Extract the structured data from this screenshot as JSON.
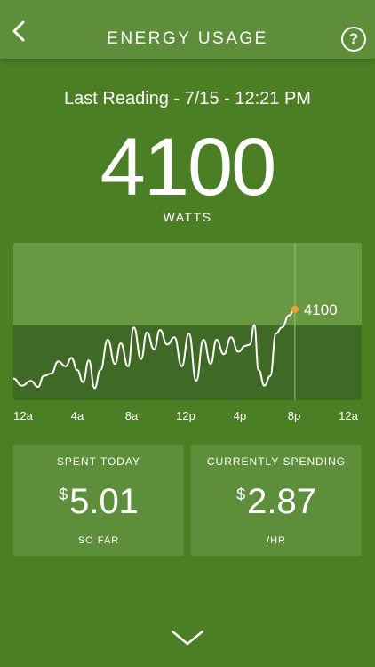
{
  "header": {
    "title": "ENERGY USAGE",
    "back_icon": "chevron-left-icon",
    "help_label": "?"
  },
  "reading": {
    "last_reading": "Last Reading - 7/15 - 12:21 PM",
    "value": "4100",
    "unit": "WATTS"
  },
  "chart_data": {
    "type": "line",
    "x_labels": [
      "12a",
      "4a",
      "8a",
      "12p",
      "4p",
      "8p",
      "12a"
    ],
    "current_value_label": "4100",
    "series": [
      {
        "values": [
          {
            "x": 0.0,
            "y": 0.18
          },
          {
            "x": 0.6,
            "y": 0.12
          },
          {
            "x": 1.2,
            "y": 0.16
          },
          {
            "x": 1.7,
            "y": 0.11
          },
          {
            "x": 2.1,
            "y": 0.2
          },
          {
            "x": 2.6,
            "y": 0.22
          },
          {
            "x": 3.1,
            "y": 0.32
          },
          {
            "x": 3.6,
            "y": 0.28
          },
          {
            "x": 4.0,
            "y": 0.35
          },
          {
            "x": 4.4,
            "y": 0.25
          },
          {
            "x": 4.8,
            "y": 0.15
          },
          {
            "x": 5.2,
            "y": 0.33
          },
          {
            "x": 5.6,
            "y": 0.1
          },
          {
            "x": 6.0,
            "y": 0.25
          },
          {
            "x": 6.5,
            "y": 0.5
          },
          {
            "x": 7.0,
            "y": 0.3
          },
          {
            "x": 7.4,
            "y": 0.47
          },
          {
            "x": 7.9,
            "y": 0.28
          },
          {
            "x": 8.3,
            "y": 0.6
          },
          {
            "x": 8.8,
            "y": 0.34
          },
          {
            "x": 9.2,
            "y": 0.56
          },
          {
            "x": 9.7,
            "y": 0.42
          },
          {
            "x": 10.1,
            "y": 0.58
          },
          {
            "x": 10.6,
            "y": 0.46
          },
          {
            "x": 11.1,
            "y": 0.52
          },
          {
            "x": 11.6,
            "y": 0.28
          },
          {
            "x": 12.1,
            "y": 0.55
          },
          {
            "x": 12.6,
            "y": 0.16
          },
          {
            "x": 13.1,
            "y": 0.5
          },
          {
            "x": 13.6,
            "y": 0.3
          },
          {
            "x": 14.0,
            "y": 0.5
          },
          {
            "x": 14.5,
            "y": 0.38
          },
          {
            "x": 15.0,
            "y": 0.52
          },
          {
            "x": 15.5,
            "y": 0.4
          },
          {
            "x": 16.0,
            "y": 0.45
          },
          {
            "x": 16.3,
            "y": 0.46
          },
          {
            "x": 16.6,
            "y": 0.62
          },
          {
            "x": 16.9,
            "y": 0.25
          },
          {
            "x": 17.3,
            "y": 0.12
          },
          {
            "x": 17.7,
            "y": 0.2
          },
          {
            "x": 18.1,
            "y": 0.55
          },
          {
            "x": 18.5,
            "y": 0.6
          },
          {
            "x": 19.0,
            "y": 0.7
          },
          {
            "x": 19.4,
            "y": 0.75
          }
        ]
      }
    ],
    "xlim": [
      0,
      24
    ],
    "ylim": [
      0,
      1.3
    ],
    "normal_band_max": 0.62,
    "current_x": 19.4,
    "colors": {
      "chart_bg": "#679943",
      "band": "#3f6a26",
      "line": "#ffffff",
      "marker": "#f0a030",
      "cursor": "#9cc07a"
    }
  },
  "cards": {
    "spent": {
      "title": "SPENT TODAY",
      "currency": "$",
      "amount": "5.01",
      "sub": "SO FAR"
    },
    "current": {
      "title": "CURRENTLY SPENDING",
      "currency": "$",
      "amount": "2.87",
      "sub": "/HR"
    }
  },
  "footer": {
    "icon": "chevron-down-icon"
  }
}
